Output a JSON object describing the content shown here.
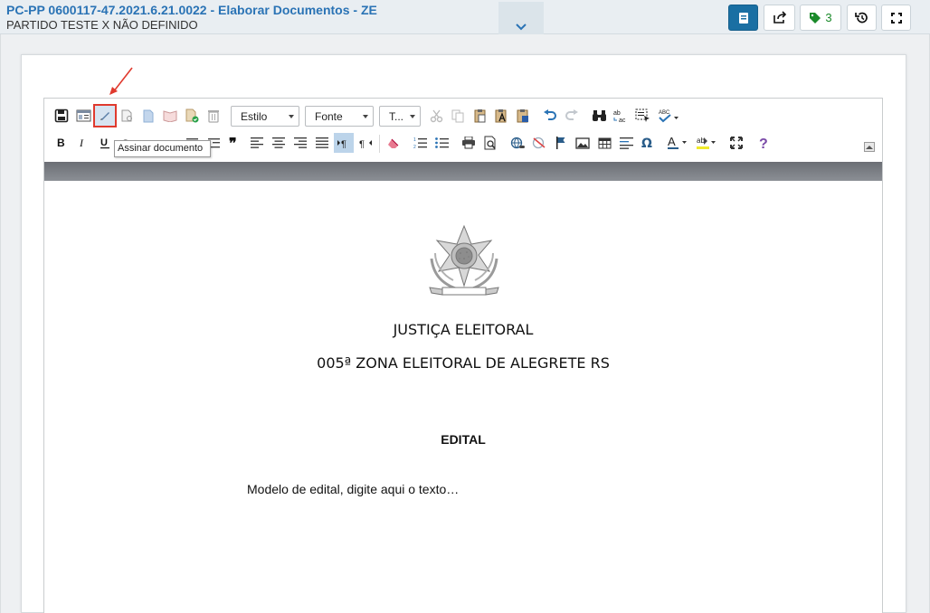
{
  "header": {
    "title": "PC-PP 0600117-47.2021.6.21.0022 - Elaborar Documentos - ZE",
    "subtitle": "PARTIDO TESTE X NÃO DEFINIDO",
    "tag_count": "3"
  },
  "toolbar": {
    "style_label": "Estilo",
    "font_label": "Fonte",
    "size_label": "T...",
    "tooltip": "Assinar documento"
  },
  "document": {
    "line1": "JUSTIÇA ELEITORAL",
    "line2": "005ª ZONA ELEITORAL DE ALEGRETE RS",
    "heading": "EDITAL",
    "body": "Modelo de edital, digite aqui o texto…"
  },
  "colors": {
    "accent": "#2a73b5",
    "primary_button": "#1a6fa3",
    "highlight_border": "#e03a2e",
    "tag_green": "#1a8a2a"
  }
}
